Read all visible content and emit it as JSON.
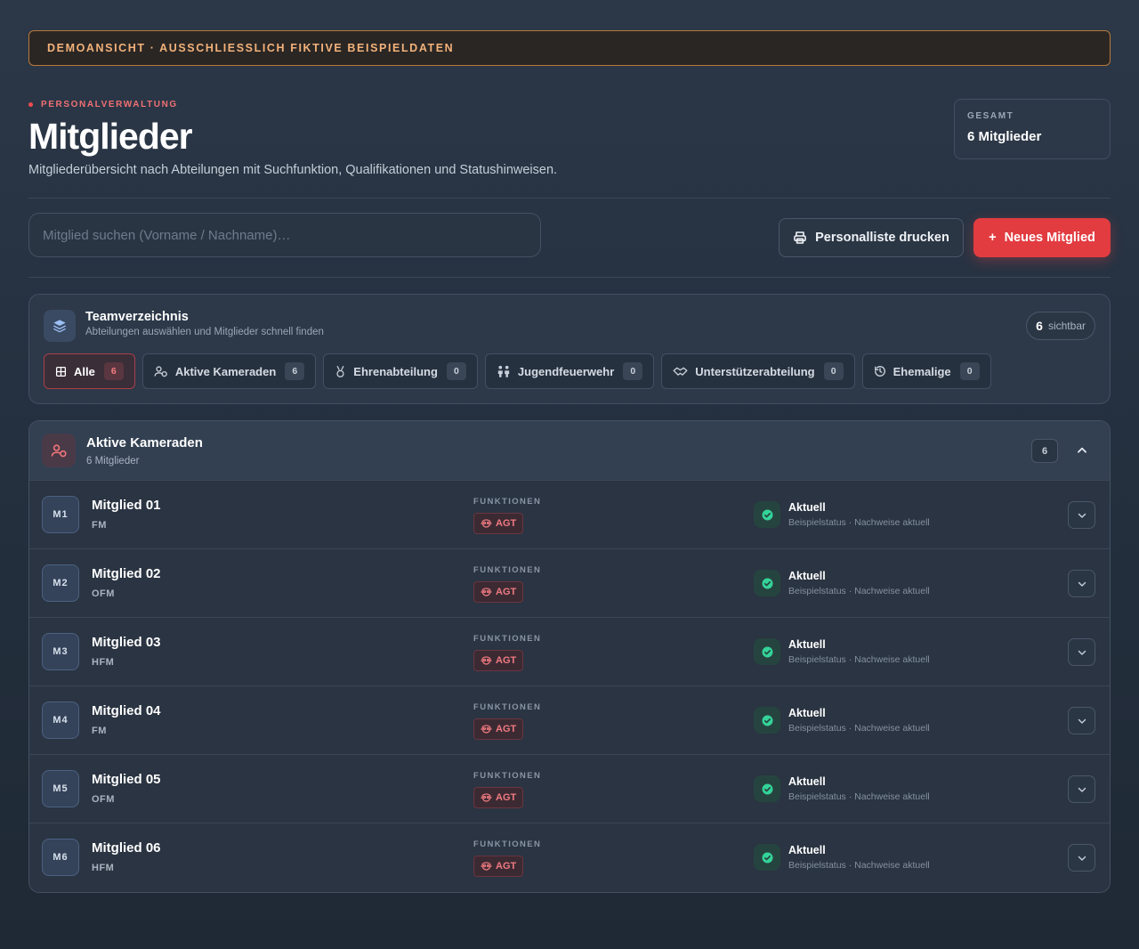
{
  "banner": {
    "text": "DEMOANSICHT · AUSSCHLIESSLICH FIKTIVE BEISPIELDATEN"
  },
  "header": {
    "eyebrow": "PERSONALVERWALTUNG",
    "title": "Mitglieder",
    "subtitle": "Mitgliederübersicht nach Abteilungen mit Suchfunktion, Qualifikationen und Statushinweisen.",
    "total_label": "GESAMT",
    "total_value": "6 Mitglieder"
  },
  "toolbar": {
    "search_placeholder": "Mitglied suchen (Vorname / Nachname)…",
    "print_label": "Personalliste drucken",
    "new_label": "Neues Mitglied",
    "new_prefix": "+"
  },
  "team": {
    "title": "Teamverzeichnis",
    "subtitle": "Abteilungen auswählen und Mitglieder schnell finden",
    "visible_count": "6",
    "visible_label": "sichtbar",
    "tabs": [
      {
        "label": "Alle",
        "count": "6",
        "icon": "grid-icon"
      },
      {
        "label": "Aktive Kameraden",
        "count": "6",
        "icon": "user-badge-icon"
      },
      {
        "label": "Ehrenabteilung",
        "count": "0",
        "icon": "medal-icon"
      },
      {
        "label": "Jugendfeuerwehr",
        "count": "0",
        "icon": "children-icon"
      },
      {
        "label": "Unterstützerabteilung",
        "count": "0",
        "icon": "handshake-icon"
      },
      {
        "label": "Ehemalige",
        "count": "0",
        "icon": "history-icon"
      }
    ]
  },
  "section": {
    "title": "Aktive Kameraden",
    "subtitle": "6 Mitglieder",
    "count": "6",
    "functions_label": "FUNKTIONEN",
    "members": [
      {
        "initials": "M1",
        "name": "Mitglied 01",
        "rank": "FM",
        "function": "AGT",
        "status": "Aktuell",
        "status_note": "Beispielstatus · Nachweise aktuell"
      },
      {
        "initials": "M2",
        "name": "Mitglied 02",
        "rank": "OFM",
        "function": "AGT",
        "status": "Aktuell",
        "status_note": "Beispielstatus · Nachweise aktuell"
      },
      {
        "initials": "M3",
        "name": "Mitglied 03",
        "rank": "HFM",
        "function": "AGT",
        "status": "Aktuell",
        "status_note": "Beispielstatus · Nachweise aktuell"
      },
      {
        "initials": "M4",
        "name": "Mitglied 04",
        "rank": "FM",
        "function": "AGT",
        "status": "Aktuell",
        "status_note": "Beispielstatus · Nachweise aktuell"
      },
      {
        "initials": "M5",
        "name": "Mitglied 05",
        "rank": "OFM",
        "function": "AGT",
        "status": "Aktuell",
        "status_note": "Beispielstatus · Nachweise aktuell"
      },
      {
        "initials": "M6",
        "name": "Mitglied 06",
        "rank": "HFM",
        "function": "AGT",
        "status": "Aktuell",
        "status_note": "Beispielstatus · Nachweise aktuell"
      }
    ]
  },
  "colors": {
    "accent": "#e23c41",
    "status_ok": "#34d399",
    "warning_border": "#b9783a"
  }
}
